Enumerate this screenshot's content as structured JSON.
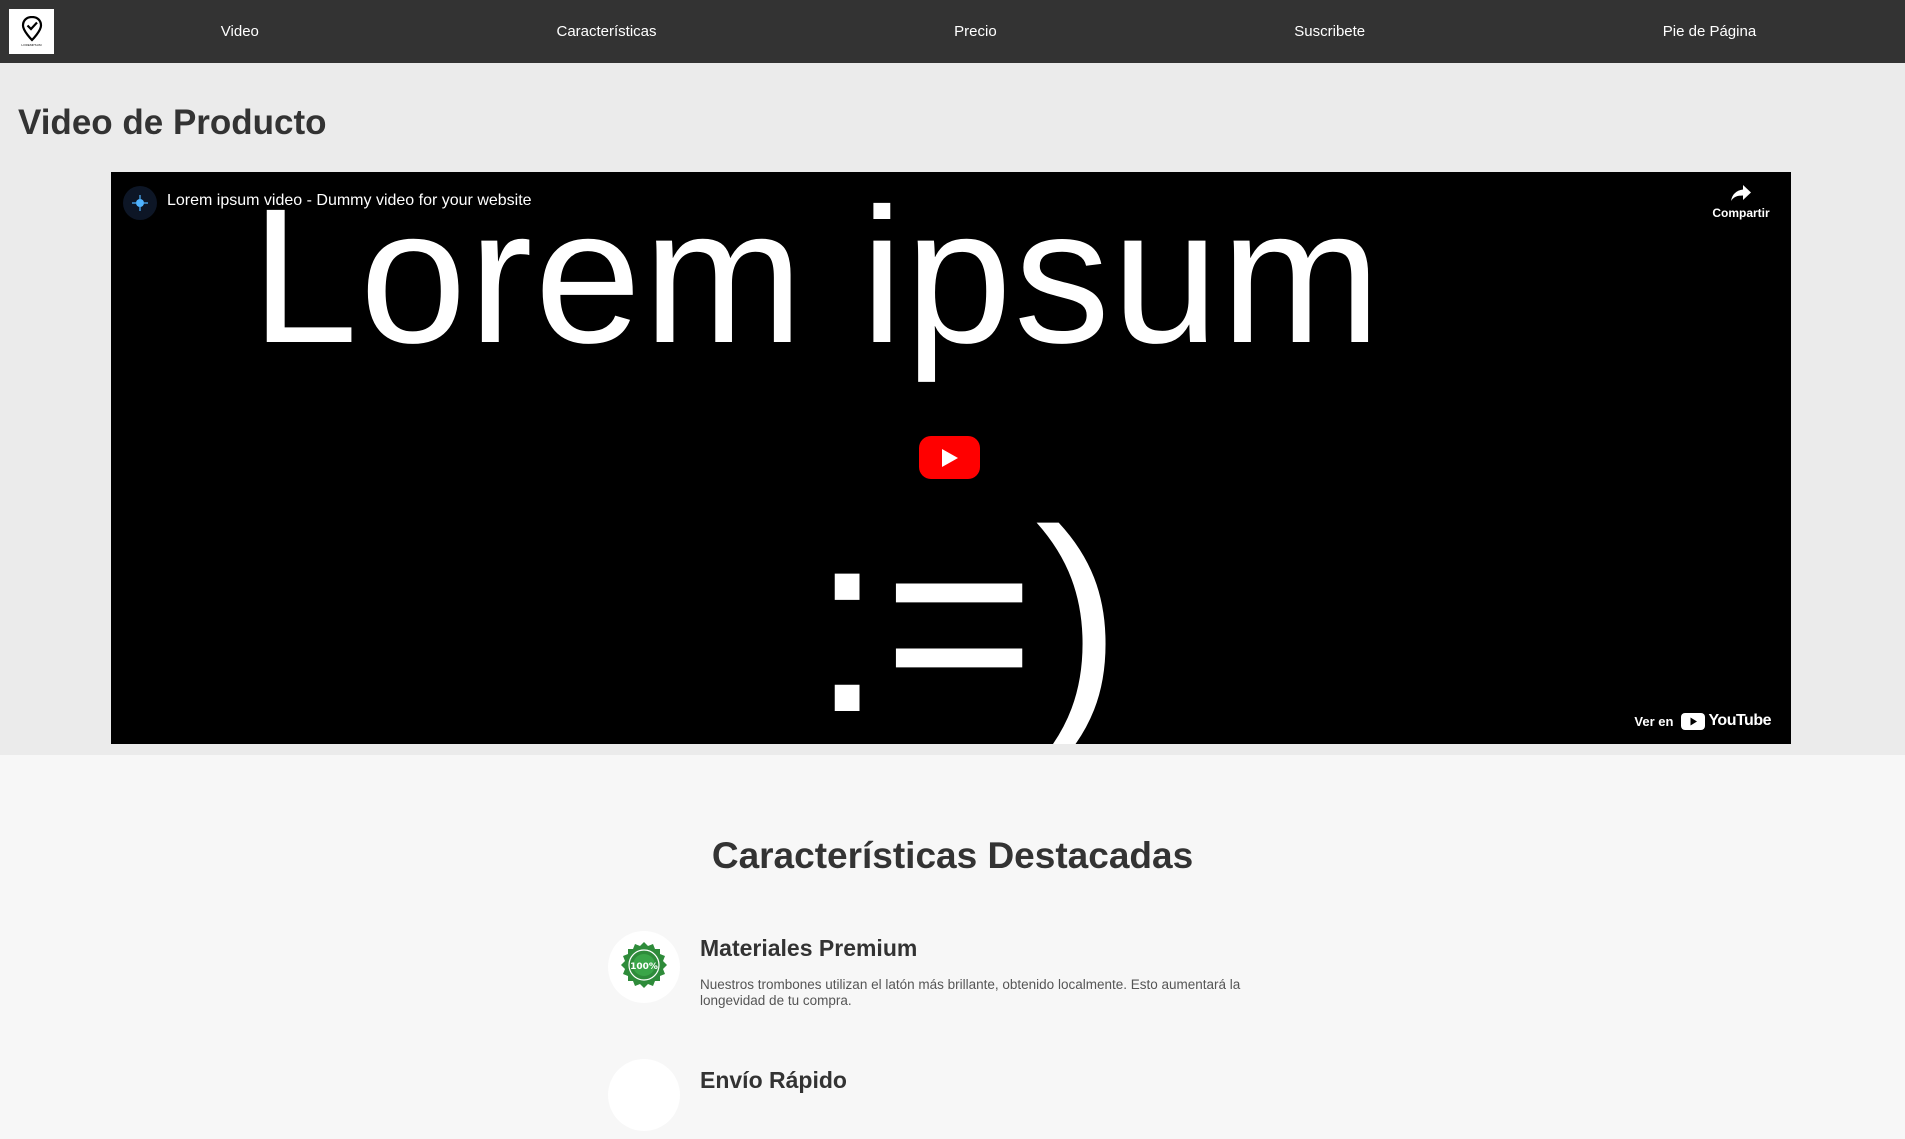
{
  "nav": {
    "logo_text": "LOREMPSUM",
    "links": [
      {
        "label": "Video"
      },
      {
        "label": "Características"
      },
      {
        "label": "Precio"
      },
      {
        "label": "Suscribete"
      },
      {
        "label": "Pie de Página"
      }
    ]
  },
  "video_section": {
    "title": "Video de Producto",
    "player": {
      "video_title": "Lorem ipsum video - Dummy video for your website",
      "frame_text": "Lorem ipsum",
      "frame_smiley": ":=)",
      "share_label": "Compartir",
      "watch_on_label": "Ver en",
      "youtube_wordmark": "YouTube",
      "play_color": "#ff0000"
    }
  },
  "features": {
    "title": "Características Destacadas",
    "items": [
      {
        "title": "Materiales Premium",
        "description": "Nuestros trombones utilizan el latón más brillante, obtenido localmente. Esto aumentará la longevidad de tu compra.",
        "icon": "premium-badge-icon",
        "icon_color": "#2e8b3a",
        "badge_text": "100%"
      },
      {
        "title": "Envío Rápido",
        "icon": "shipping-icon"
      }
    ]
  }
}
